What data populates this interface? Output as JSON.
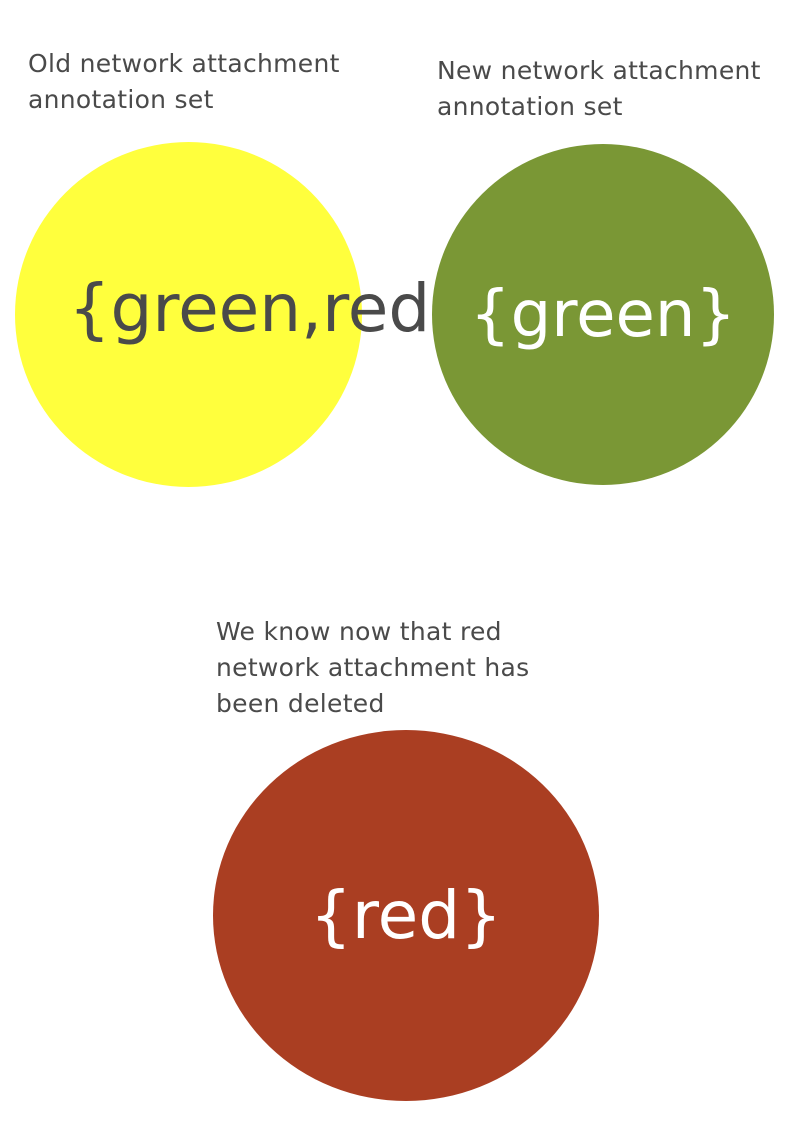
{
  "old_set": {
    "caption": "Old network attachment annotation set",
    "label": "{green,red}",
    "color": "#ffff3d",
    "text_color": "#4a4a4a"
  },
  "new_set": {
    "caption": "New network attachment annotation set",
    "label": "{green}",
    "color": "#7a9735",
    "text_color": "#ffffff"
  },
  "result_set": {
    "caption": "We know now that red network attachment has been deleted",
    "label": "{red}",
    "color": "#aa3e22",
    "text_color": "#ffffff"
  }
}
